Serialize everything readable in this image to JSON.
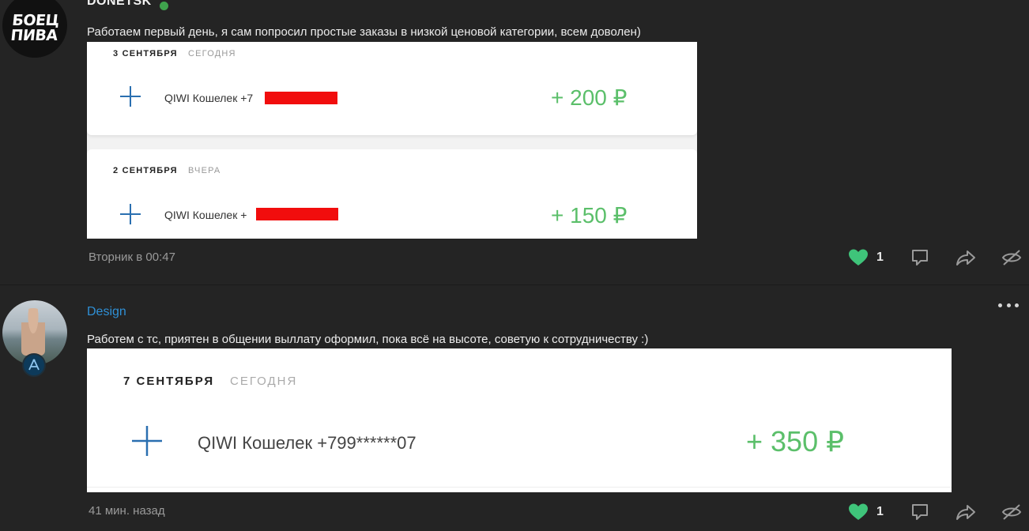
{
  "posts": [
    {
      "author": "DONETSK",
      "avatar_text": "БОЕЦ ПИВА",
      "online": true,
      "text": "Работаем первый день, я сам попросил простые заказы в низкой ценовой категории, всем доволен)",
      "time": "Вторник в 00:47",
      "likes": "1",
      "attachment": {
        "cards": [
          {
            "date": "3 СЕНТЯБРЯ",
            "relative": "СЕГОДНЯ",
            "icon": "plus-icon",
            "wallet": "QIWI Кошелек +7",
            "amount": "+ 200 ₽"
          },
          {
            "date": "2 СЕНТЯБРЯ",
            "relative": "ВЧЕРА",
            "icon": "plus-icon",
            "wallet": "QIWI Кошелек +",
            "amount": "+ 150 ₽"
          }
        ]
      }
    },
    {
      "author": "Design",
      "text": "Работем с тс, приятен в общении выллату оформил, пока всё на высоте, советую к сотрудничеству :)",
      "time": "41 мин. назад",
      "likes": "1",
      "attachment": {
        "date": "7 СЕНТЯБРЯ",
        "relative": "СЕГОДНЯ",
        "icon": "plus-icon",
        "wallet": "QIWI Кошелек +799******07",
        "amount": "+ 350 ₽"
      }
    }
  ],
  "icons": {
    "like": "heart-icon",
    "comment": "comment-icon",
    "share": "share-icon",
    "hide": "hide-icon",
    "more": "more-icon",
    "badge": "designer-badge-icon"
  },
  "colors": {
    "background": "#242424",
    "like": "#3fc47a",
    "author_link": "#2f90d6",
    "amount": "#5bbf6a",
    "redaction": "#f10d0d"
  }
}
